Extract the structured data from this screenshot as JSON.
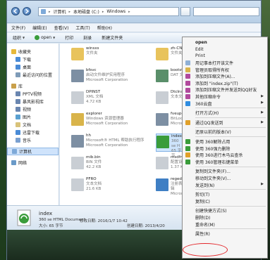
{
  "address": {
    "segments": [
      "计算机",
      "本地磁盘 (C:)",
      "Windows"
    ]
  },
  "menubar": [
    "文件(F)",
    "编辑(E)",
    "查看(V)",
    "工具(T)",
    "帮助(H)"
  ],
  "toolbar": {
    "organize": "组织",
    "open": "open",
    "print": "打印",
    "burn": "刻录",
    "new_folder": "新建文件夹"
  },
  "nav": [
    {
      "label": "收藏夹",
      "icon": "star-icon",
      "sub": false
    },
    {
      "label": "下载",
      "icon": "download-icon",
      "sub": true
    },
    {
      "label": "桌面",
      "icon": "desktop-icon",
      "sub": true
    },
    {
      "label": "最近访问的位置",
      "icon": "recent-places-icon",
      "sub": true
    },
    {
      "label": "库",
      "icon": "library-icon",
      "sub": false,
      "gap": true
    },
    {
      "label": "PPTV视频",
      "icon": "video-library-icon",
      "sub": true
    },
    {
      "label": "暴风影视库",
      "icon": "video-library-icon",
      "sub": true
    },
    {
      "label": "视频",
      "icon": "video-library-icon",
      "sub": true
    },
    {
      "label": "图片",
      "icon": "pictures-library-icon",
      "sub": true
    },
    {
      "label": "文档",
      "icon": "documents-library-icon",
      "sub": true
    },
    {
      "label": "迅雷下载",
      "icon": "download-icon",
      "sub": true
    },
    {
      "label": "音乐",
      "icon": "music-library-icon",
      "sub": true
    },
    {
      "label": "计算机",
      "icon": "computer-icon",
      "sub": false,
      "gap": true,
      "selected": true
    },
    {
      "label": "网络",
      "icon": "network-icon",
      "sub": false,
      "gap": true
    }
  ],
  "files": [
    {
      "name": "winsxs",
      "desc": "文件夹",
      "extra": "",
      "icon": "folder-icon",
      "color": "#e8c35c"
    },
    {
      "name": "zh-CN",
      "desc": "文件夹",
      "extra": "",
      "icon": "folder-icon",
      "color": "#e8c35c"
    },
    {
      "name": "bfsvc",
      "desc": "启动文件维护实用程序",
      "extra": "Microsoft Corporation",
      "icon": "exe-icon",
      "color": "#7d8fa3"
    },
    {
      "name": "bootstat.",
      "desc": "DAT 文件",
      "extra": "",
      "icon": "dat-icon",
      "color": "#5a8f6a"
    },
    {
      "name": "DPINST",
      "desc": "XML 文档",
      "extra": "4.72 KB",
      "icon": "xml-doc-icon",
      "color": "#c9ced4"
    },
    {
      "name": "DtcInstall",
      "desc": "文本文档",
      "extra": "",
      "icon": "text-doc-icon",
      "color": "#c9ced4"
    },
    {
      "name": "explorer",
      "desc": "Windows 资源管理器",
      "extra": "Microsoft Corporation",
      "icon": "explorer-icon",
      "color": "#d9b44a"
    },
    {
      "name": "fveupdat",
      "desc": "BitLocker",
      "extra": "Microsoft",
      "icon": "bitlocker-icon",
      "color": "#7d8fa3"
    },
    {
      "name": "hh",
      "desc": "Microsoft® HTML 帮助执行程序",
      "extra": "Microsoft Corporation",
      "icon": "help-icon",
      "color": "#7d8fa3"
    },
    {
      "name": "index",
      "desc": "360 se H",
      "extra": "65 字节",
      "icon": "html-doc-icon",
      "color": "#3a9c3a",
      "selected": true
    },
    {
      "name": "mib.bin",
      "desc": "BIN 文件",
      "extra": "42.2 KB",
      "icon": "bin-file-icon",
      "color": "#c9ced4"
    },
    {
      "name": "msdfmap",
      "desc": "配置设置",
      "extra": "1.37 KB",
      "icon": "config-icon",
      "color": "#c9ced4"
    },
    {
      "name": "PFRO",
      "desc": "文本文档",
      "extra": "21.6 KB",
      "icon": "text-doc-icon",
      "color": "#c9ced4"
    },
    {
      "name": "regedit",
      "desc": "注册表编辑",
      "extra": "Microsoft",
      "icon": "regedit-icon",
      "color": "#3f7fc4"
    }
  ],
  "details": {
    "name": "index",
    "type": "360 se HTML Document",
    "size_label": "大小: 65 字节",
    "modified": "修改日期: 2016/1/7 10:42",
    "created": "创建日期: 2013/4/20"
  },
  "context_menu": [
    {
      "label": "open",
      "bold": true
    },
    {
      "label": "Edit"
    },
    {
      "label": "Print"
    },
    {
      "label": "用记事本打开该文件",
      "icon": "notepad-icon",
      "color": "#8fb0d6"
    },
    {
      "label": "管理员取得所有权",
      "icon": "admin-icon",
      "color": "#d9b44a"
    },
    {
      "label": "添加到压缩文件(A)...",
      "icon": "archive-icon",
      "color": "#b14a9d"
    },
    {
      "label": "添加到 \"index.zip\"(T)",
      "icon": "archive-icon",
      "color": "#b14a9d"
    },
    {
      "label": "添加到压缩文件并发送到QQ好友",
      "icon": "archive-icon",
      "color": "#b14a9d"
    },
    {
      "label": "其他压缩命令",
      "icon": "archive-icon",
      "color": "#b14a9d",
      "arrow": true
    },
    {
      "label": "360云盘",
      "icon": "cloud-icon",
      "color": "#2f8de0",
      "arrow": true
    },
    {
      "sep": true
    },
    {
      "label": "打开方式(H)",
      "arrow": true
    },
    {
      "sep": true
    },
    {
      "label": "通过QQ发送到",
      "icon": "qq-icon",
      "color": "#e0a02a",
      "arrow": true
    },
    {
      "sep": true
    },
    {
      "label": "还原以前的版本(V)"
    },
    {
      "sep": true
    },
    {
      "label": "使用 360解除占用",
      "icon": "360-icon",
      "color": "#3a9c3a"
    },
    {
      "label": "使用 360强力删除",
      "icon": "360-icon",
      "color": "#3a9c3a"
    },
    {
      "label": "使用 360进行木马云查杀",
      "icon": "360-icon",
      "color": "#e0a02a"
    },
    {
      "label": "使用 360管理右键菜单",
      "icon": "360-icon",
      "color": "#3a9c3a"
    },
    {
      "sep": true
    },
    {
      "label": "复制到文件夹(F)..."
    },
    {
      "label": "移动到文件夹(V)..."
    },
    {
      "label": "发送到(N)",
      "arrow": true
    },
    {
      "sep": true
    },
    {
      "label": "剪切(T)"
    },
    {
      "label": "复制(C)"
    },
    {
      "sep": true
    },
    {
      "label": "创建快捷方式(S)"
    },
    {
      "label": "删除(D)"
    },
    {
      "label": "重命名(M)"
    },
    {
      "sep": true
    },
    {
      "label": "属性(R)"
    }
  ],
  "colors": {
    "highlight": "#e3262a",
    "selection": "#cde4fb"
  }
}
